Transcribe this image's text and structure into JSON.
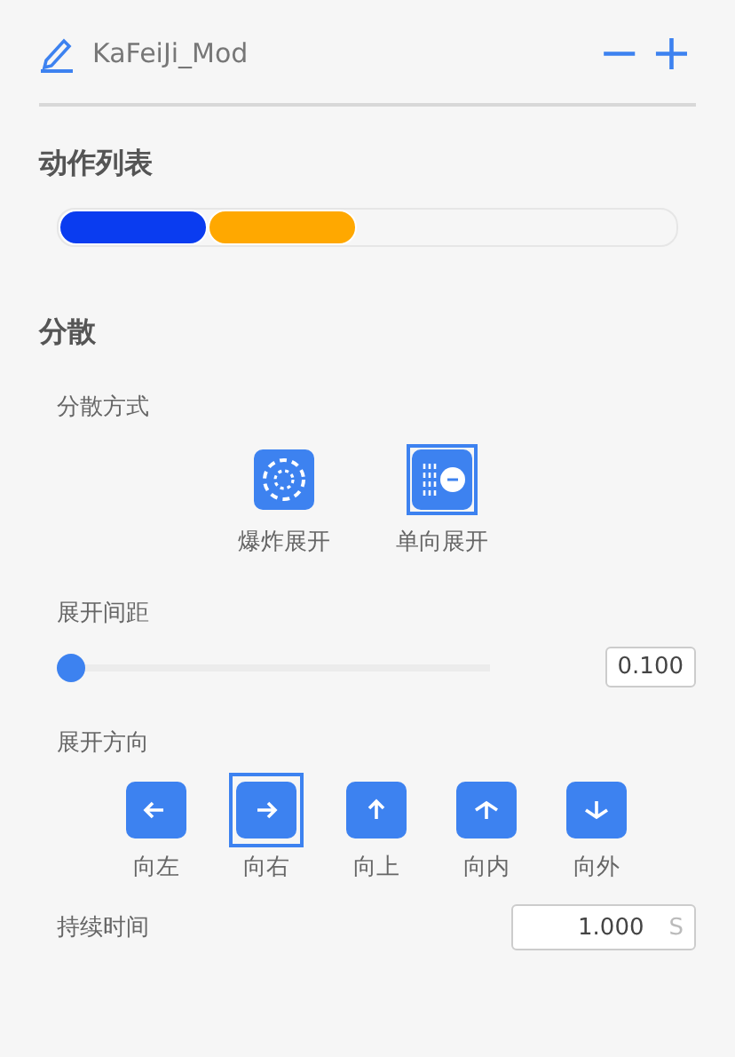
{
  "header": {
    "title": "KaFeiJi_Mod",
    "buttons": [
      "−",
      "+"
    ]
  },
  "action_list": {
    "title": "动作列表",
    "segments": [
      {
        "color": "#0a3cf0"
      },
      {
        "color": "#ffa800"
      }
    ]
  },
  "section": {
    "title": "分散"
  },
  "mode": {
    "label": "分散方式",
    "options": [
      {
        "kind": "burst",
        "label": "爆炸展开",
        "selected": false
      },
      {
        "kind": "single",
        "label": "单向展开",
        "selected": true
      }
    ]
  },
  "spacing": {
    "label": "展开间距",
    "level": 0,
    "value": "0.100"
  },
  "direction": {
    "label": "展开方向",
    "options": [
      {
        "kind": "left",
        "label": "向左",
        "selected": false
      },
      {
        "kind": "right",
        "label": "向右",
        "selected": true
      },
      {
        "kind": "up",
        "label": "向上",
        "selected": false
      },
      {
        "kind": "in",
        "label": "向内",
        "selected": false
      },
      {
        "kind": "out",
        "label": "向外",
        "selected": false
      }
    ]
  },
  "duration": {
    "label": "持续时间",
    "value": "1.000",
    "unit": "S"
  }
}
